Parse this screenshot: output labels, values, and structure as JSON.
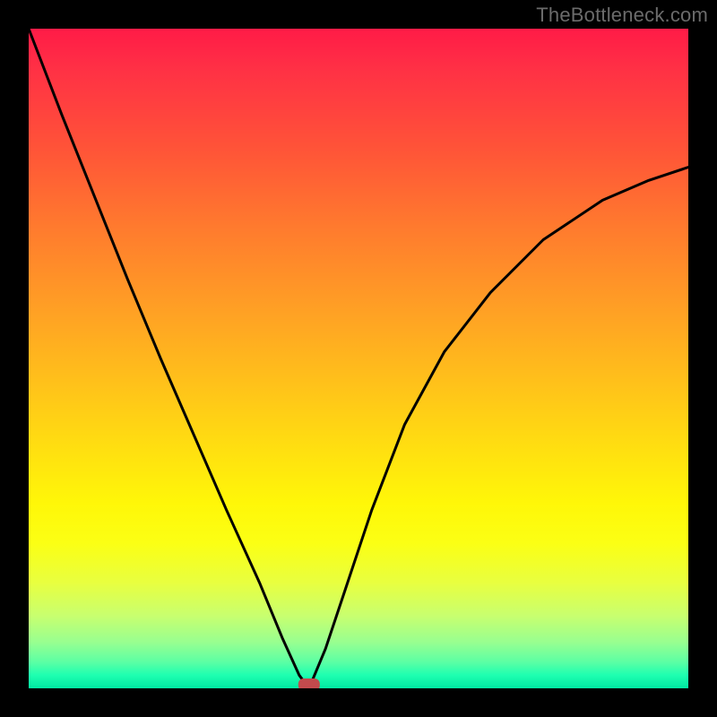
{
  "watermark": "TheBottleneck.com",
  "colors": {
    "frame": "#000000",
    "gradient_top": "#ff1b47",
    "gradient_mid": "#ffe010",
    "gradient_bottom": "#00e9a2",
    "curve": "#000000",
    "marker": "#c24a4d"
  },
  "chart_data": {
    "type": "line",
    "title": "",
    "xlabel": "",
    "ylabel": "",
    "xlim": [
      0,
      1
    ],
    "ylim": [
      0,
      1
    ],
    "legend": false,
    "grid": false,
    "annotations": [],
    "series": [
      {
        "name": "left-branch",
        "x": [
          0.0,
          0.05,
          0.1,
          0.15,
          0.2,
          0.25,
          0.3,
          0.35,
          0.385,
          0.41,
          0.425
        ],
        "y": [
          1.0,
          0.87,
          0.745,
          0.62,
          0.5,
          0.385,
          0.27,
          0.16,
          0.075,
          0.02,
          0.0
        ]
      },
      {
        "name": "right-branch",
        "x": [
          0.425,
          0.45,
          0.48,
          0.52,
          0.57,
          0.63,
          0.7,
          0.78,
          0.87,
          0.94,
          1.0
        ],
        "y": [
          0.0,
          0.06,
          0.15,
          0.27,
          0.4,
          0.51,
          0.6,
          0.68,
          0.74,
          0.77,
          0.79
        ]
      }
    ],
    "marker": {
      "x": 0.425,
      "y": 0.0
    }
  }
}
